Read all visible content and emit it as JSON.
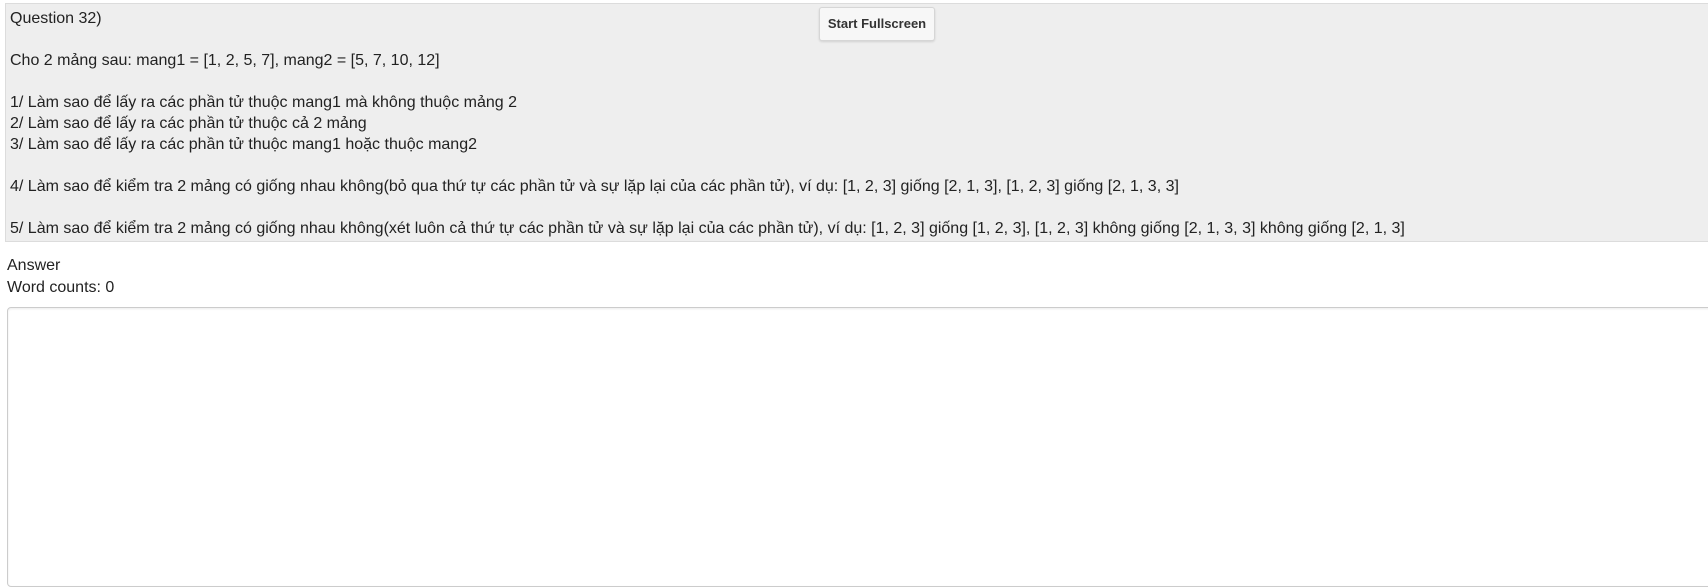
{
  "question": {
    "title": "Question 32)",
    "lines": [
      "",
      "Cho 2 mảng sau: mang1 = [1, 2, 5, 7], mang2 = [5, 7, 10, 12]",
      "",
      "1/ Làm sao để lấy ra các phần tử thuộc mang1 mà không thuộc mảng 2",
      "2/ Làm sao để lấy ra các phần tử thuộc cả 2 mảng",
      "3/ Làm sao để lấy ra các phần tử thuộc mang1 hoặc thuộc mang2",
      "",
      "4/ Làm sao để kiểm tra 2 mảng có giống nhau không(bỏ qua thứ tự các phần tử và sự lặp lại của các phần tử), ví dụ: [1, 2, 3] giống [2, 1, 3], [1, 2, 3] giống [2, 1, 3, 3]",
      "",
      "5/ Làm sao để kiểm tra 2 mảng có giống nhau không(xét luôn cả thứ tự các phần tử và sự lặp lại của các phần tử), ví dụ: [1, 2, 3] giống [1, 2, 3], [1, 2, 3] không giống [2, 1, 3, 3] không giống [2, 1, 3]"
    ]
  },
  "toolbar": {
    "fullscreen_label": "Start Fullscreen"
  },
  "answer": {
    "label": "Answer",
    "word_counts_label": "Word counts: 0",
    "value": ""
  }
}
